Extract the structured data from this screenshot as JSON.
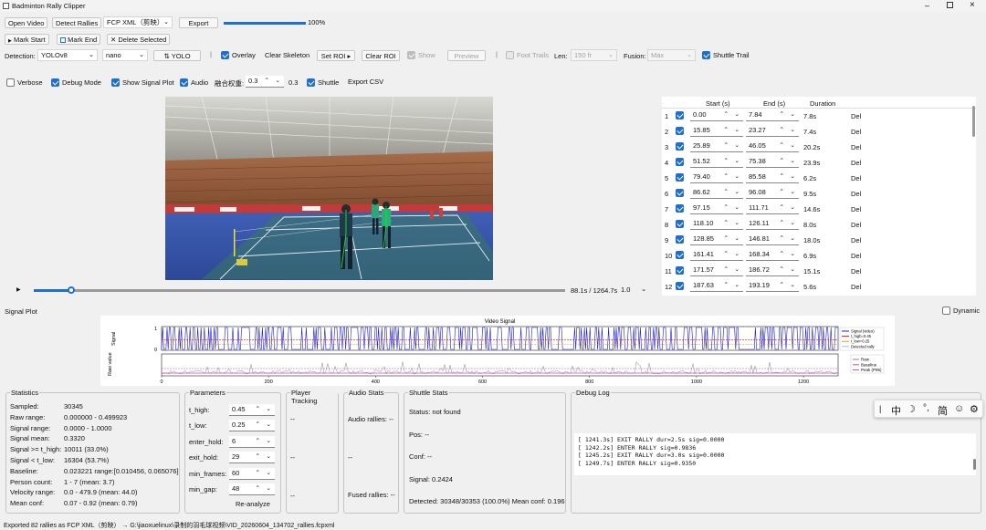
{
  "window": {
    "title": "Badminton Rally Clipper"
  },
  "toolbar1": {
    "open_video": "Open Video",
    "detect_rallies": "Detect Rallies",
    "format": "FCP XML（剪映）",
    "export": "Export",
    "progress_value": 1.0,
    "progress_text": "100%"
  },
  "toolbar2": {
    "mark_start": "Mark Start",
    "mark_end": "Mark End",
    "delete_selected": "Delete Selected"
  },
  "toolbar3": {
    "detection_label": "Detection:",
    "model": "YOLOv8",
    "size": "nano",
    "yolo_btn": "YOLO",
    "overlay": "Overlay",
    "clear_skeleton": "Clear Skeleton",
    "set_roi": "Set ROI ▸",
    "clear_roi": "Clear ROI",
    "show": "Show",
    "preview": "Preview",
    "foot_trails": "Foot Trails",
    "len_label": "Len:",
    "len_value": "150 fr",
    "fusion_label": "Fusion:",
    "fusion_value": "Max",
    "shuttle_trail": "Shuttle Trail"
  },
  "toolbar4": {
    "verbose": "Verbose",
    "debug_mode": "Debug Mode",
    "show_signal_plot": "Show Signal Plot",
    "audio": "Audio",
    "fusion_weight_label": "融合权重:",
    "fusion_weight_value": "0.3",
    "fusion_weight_text": "0.3",
    "shuttle": "Shuttle",
    "export_csv": "Export CSV"
  },
  "player": {
    "time": "88.1s / 1264.7s",
    "speed": "1.0",
    "play_icon": "play-icon",
    "position": 0.0697
  },
  "rally_table": {
    "headers": [
      "Start (s)",
      "End (s)",
      "Duration"
    ],
    "del_label": "Del",
    "rows": [
      {
        "n": "1",
        "start": "0.00",
        "end": "7.84",
        "dur": "7.8s"
      },
      {
        "n": "2",
        "start": "15.85",
        "end": "23.27",
        "dur": "7.4s"
      },
      {
        "n": "3",
        "start": "25.89",
        "end": "46.05",
        "dur": "20.2s"
      },
      {
        "n": "4",
        "start": "51.52",
        "end": "75.38",
        "dur": "23.9s"
      },
      {
        "n": "5",
        "start": "79.40",
        "end": "85.58",
        "dur": "6.2s"
      },
      {
        "n": "6",
        "start": "86.62",
        "end": "96.08",
        "dur": "9.5s"
      },
      {
        "n": "7",
        "start": "97.15",
        "end": "111.71",
        "dur": "14.6s"
      },
      {
        "n": "8",
        "start": "118.10",
        "end": "126.11",
        "dur": "8.0s"
      },
      {
        "n": "9",
        "start": "128.85",
        "end": "146.81",
        "dur": "18.0s"
      },
      {
        "n": "10",
        "start": "161.41",
        "end": "168.34",
        "dur": "6.9s"
      },
      {
        "n": "11",
        "start": "171.57",
        "end": "186.72",
        "dur": "15.1s"
      },
      {
        "n": "12",
        "start": "187.63",
        "end": "193.19",
        "dur": "5.6s"
      }
    ]
  },
  "signal_plot": {
    "label": "Signal Plot",
    "dynamic": "Dynamic"
  },
  "chart_data": {
    "type": "line",
    "title": "Video Signal",
    "xlim": [
      0,
      1264.7
    ],
    "xticks": [
      "0",
      "200",
      "400",
      "600",
      "800",
      "1000",
      "1200"
    ],
    "top": {
      "ylabel": "Signal",
      "yticks": [
        "0",
        "1"
      ],
      "ylim": [
        0,
        1
      ],
      "t_high": 0.45,
      "t_low": 0.25,
      "legend": [
        "Signal (video)",
        "t_high=0.45",
        "t_low=0.25",
        "Detected rally"
      ]
    },
    "bottom": {
      "ylabel": "Raw value",
      "legend": [
        "Raw",
        "Baseline",
        "Peak (P95)"
      ]
    },
    "colors": {
      "signal": "#1c1cd0",
      "t_high": "#d02020",
      "t_low": "#e0a020",
      "raw": "#8a8a8a",
      "baseline": "#c050c0",
      "peak": "#9b59b6"
    }
  },
  "statistics": {
    "title": "Statistics",
    "rows": [
      {
        "k": "Sampled:",
        "v": "30345"
      },
      {
        "k": "Raw range:",
        "v": "0.000000 - 0.499923"
      },
      {
        "k": "Signal range:",
        "v": "0.0000 - 1.0000"
      },
      {
        "k": "Signal mean:",
        "v": "0.3320"
      },
      {
        "k": "Signal >= t_high:",
        "v": "10011 (33.0%)"
      },
      {
        "k": "Signal < t_low:",
        "v": "16304 (53.7%)"
      },
      {
        "k": "Baseline:",
        "v": "0.023221   range:[0.010456, 0.065076]"
      },
      {
        "k": "Person count:",
        "v": "1 - 7 (mean: 3.7)"
      },
      {
        "k": "Velocity range:",
        "v": "0.0 - 479.9 (mean: 44.0)"
      },
      {
        "k": "Mean conf:",
        "v": "0.07 - 0.92 (mean: 0.79)"
      }
    ]
  },
  "parameters": {
    "title": "Parameters",
    "reanalyze": "Re-analyze",
    "rows": [
      {
        "k": "t_high:",
        "v": "0.45"
      },
      {
        "k": "t_low:",
        "v": "0.25"
      },
      {
        "k": "enter_hold:",
        "v": "6"
      },
      {
        "k": "exit_hold:",
        "v": "29"
      },
      {
        "k": "min_frames:",
        "v": "60"
      },
      {
        "k": "min_gap:",
        "v": "48"
      }
    ]
  },
  "player_tracking": {
    "title": "Player Tracking",
    "v1": "--",
    "v2": "--",
    "v3": "--"
  },
  "audio_stats": {
    "title": "Audio Stats",
    "audio_rallies": "Audio rallies: --",
    "mid": "--",
    "fused": "Fused rallies: --"
  },
  "shuttle_stats": {
    "title": "Shuttle Stats",
    "status": "Status: not found",
    "pos": "Pos: --",
    "conf": "Conf: --",
    "signal": "Signal: 0.2424",
    "detected": "Detected: 30348/30353 (100.0%)  Mean conf: 0.196"
  },
  "debug_log": {
    "title": "Debug Log",
    "lines": [
      "[ 1241.3s] EXIT RALLY   dur=2.5s  sig=0.0000",
      "[ 1242.2s] ENTER RALLY  sig=0.9836",
      "[ 1245.2s] EXIT RALLY   dur=3.0s  sig=0.0000",
      "[ 1249.7s] ENTER RALLY  sig=0.9350"
    ]
  },
  "ime": {
    "items": [
      "中",
      "☽",
      "°,",
      "简",
      "☺",
      "⚙"
    ]
  },
  "status_bar": {
    "text": "Exported 82 rallies as FCP XML（剪映） → G:\\jiaoxuelinux\\录制的羽毛球视频\\VID_20260604_134702_rallies.fcpxml"
  }
}
